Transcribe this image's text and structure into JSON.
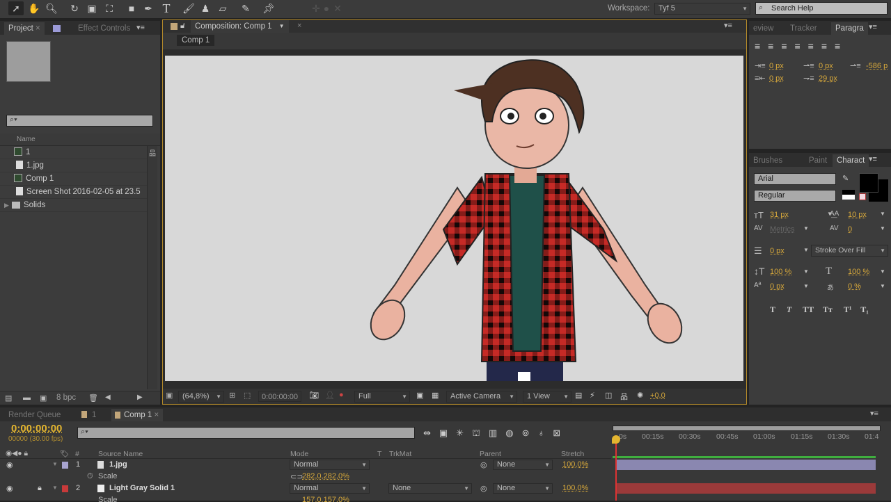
{
  "toolbar": {
    "tools": [
      "selection-tool",
      "hand-tool",
      "zoom-tool",
      "rotation-tool",
      "camera-tool",
      "pan-behind-tool",
      "rectangle-tool",
      "pen-tool",
      "type-tool",
      "brush-tool",
      "clone-stamp-tool",
      "eraser-tool",
      "roto-brush-tool",
      "puppet-pin-tool"
    ],
    "workspace_label": "Workspace:",
    "workspace_value": "Tyf 5",
    "search_placeholder": "Search Help"
  },
  "project": {
    "tab_label": "Project",
    "effect_controls_label": "Effect Controls",
    "name_header": "Name",
    "items": [
      {
        "name": "1",
        "type": "composition"
      },
      {
        "name": "1.jpg",
        "type": "image"
      },
      {
        "name": "Comp 1",
        "type": "composition"
      },
      {
        "name": "Screen Shot 2016-02-05 at 23.5",
        "type": "image"
      },
      {
        "name": "Solids",
        "type": "folder"
      }
    ],
    "bpc": "8 bpc"
  },
  "composition": {
    "tab_label": "Composition: Comp 1",
    "sub_tab": "Comp 1",
    "zoom": "(64,8%)",
    "timecode": "0:00:00:00",
    "resolution": "Full",
    "camera": "Active Camera",
    "views": "1 View",
    "exposure": "+0,0",
    "canvas_color": "#d8d8d8"
  },
  "paragraph": {
    "tabs": [
      "eview",
      "Tracker",
      "Paragra"
    ],
    "indent_left": "0 px",
    "indent_first": "0 px",
    "indent_right": "-586 p",
    "space_before": "0 px",
    "space_after": "29 px"
  },
  "character": {
    "tabs": [
      "Brushes",
      "Paint",
      "Charact"
    ],
    "font": "Arial",
    "style": "Regular",
    "size": "31 px",
    "leading": "10 px",
    "kerning": "Metrics",
    "tracking": "0",
    "stroke_width": "0 px",
    "stroke_mode": "Stroke Over Fill",
    "vertical_scale": "100 %",
    "horizontal_scale": "100 %",
    "baseline_shift": "0 px",
    "tsume": "0 %",
    "style_buttons": [
      "T",
      "T",
      "TT",
      "Tт",
      "T¹",
      "T₁"
    ]
  },
  "timeline": {
    "tabs": [
      "Render Queue",
      "1",
      "Comp 1"
    ],
    "timecode": "0:00:00:00",
    "frame_info": "00000 (30.00 fps)",
    "columns": {
      "source": "Source Name",
      "mode": "Mode",
      "t": "T",
      "trkmat": "TrkMat",
      "parent": "Parent",
      "stretch": "Stretch",
      "number": "#"
    },
    "ruler": [
      "0s",
      "00:15s",
      "00:30s",
      "00:45s",
      "01:00s",
      "01:15s",
      "01:30s",
      "01:4"
    ],
    "layers": [
      {
        "num": "1",
        "name": "1.jpg",
        "label_color": "#a8a4d0",
        "mode": "Normal",
        "trkmat": "",
        "parent": "None",
        "stretch": "100,0%",
        "prop": "Scale",
        "prop_value": "282,0,282,0%",
        "bar_color": "#8a87b0"
      },
      {
        "num": "2",
        "name": "Light Gray Solid 1",
        "label_color": "#c83a3a",
        "mode": "Normal",
        "trkmat": "None",
        "parent": "None",
        "stretch": "100,0%",
        "prop": "Scale",
        "prop_value": "157,0,157,0%",
        "bar_color": "#9b3a3a"
      }
    ]
  }
}
